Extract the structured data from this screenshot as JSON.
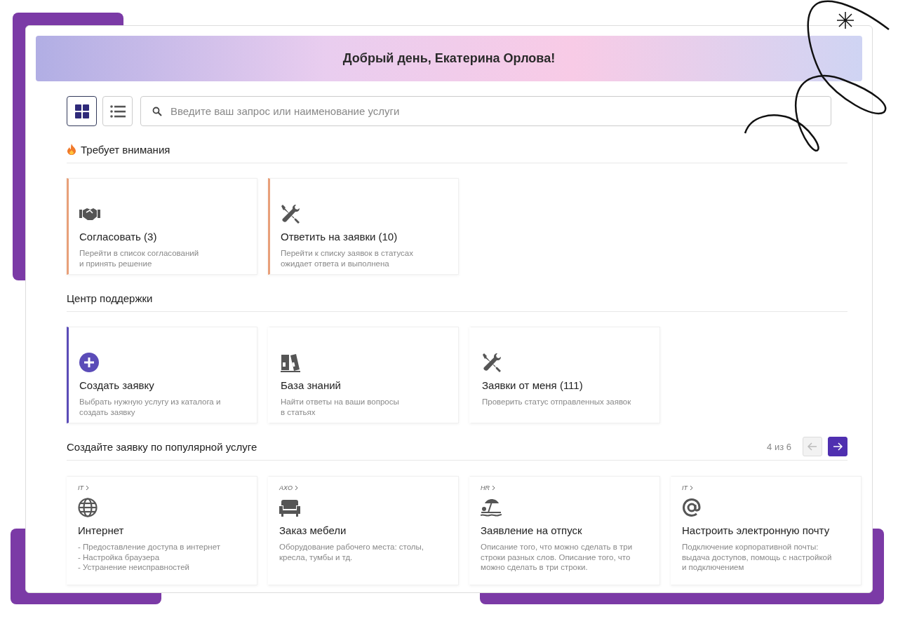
{
  "greeting": "Добрый день, Екатерина Орлова!",
  "view_buttons": [
    {
      "kind": "grid",
      "selected": true
    },
    {
      "kind": "list",
      "selected": false
    }
  ],
  "search": {
    "placeholder": "Введите ваш запрос или наименование услуги"
  },
  "attention": {
    "title": "Требует внимания",
    "cards": [
      {
        "kind": "handshake",
        "title": "Согласовать (3)",
        "lines": [
          "Перейти в список согласований",
          "и принять решение"
        ],
        "color": "#e8a07a"
      },
      {
        "kind": "tools",
        "title": "Ответить на заявки (10)",
        "lines": [
          "Перейти к списку заявок в статусах",
          "ожидает ответа и выполнена"
        ],
        "color": "#e8a07a"
      }
    ]
  },
  "support": {
    "title": "Центр поддержки",
    "cards": [
      {
        "kind": "plus",
        "title": "Создать заявку",
        "lines": [
          "Выбрать нужную услугу из каталога и",
          "создать заявку"
        ],
        "color": "#5b4cb8"
      },
      {
        "kind": "books",
        "title": "База знаний",
        "lines": [
          "Найти ответы на ваши вопросы",
          "в статьях"
        ]
      },
      {
        "kind": "tools",
        "title": "Заявки от меня (111)",
        "lines": [
          "Проверить статус отправленных заявок"
        ]
      }
    ]
  },
  "popular": {
    "title": "Создайте заявку по популярной услуге",
    "pager": "4 из 6",
    "prev_disabled": true,
    "next_disabled": false,
    "cards": [
      {
        "category": "IT",
        "kind": "globe",
        "title": "Интернет",
        "lines": [
          "- Предоставление доступа в интернет",
          "- Настройка браузера",
          "- Устранение неисправностей"
        ]
      },
      {
        "category": "AXO",
        "kind": "chair",
        "title": "Заказ мебели",
        "lines": [
          "Оборудование рабочего места: столы,",
          "кресла, тумбы и тд."
        ]
      },
      {
        "category": "HR",
        "kind": "beach",
        "title": "Заявление на отпуск",
        "lines": [
          "Описание того, что можно сделать в три",
          "строки разных слов. Описание того, что",
          "можно сделать в три строки."
        ]
      },
      {
        "category": "IT",
        "kind": "at",
        "title": "Настроить электронную почту",
        "lines": [
          "Подключение корпоративной почты:",
          "выдача доступов, помощь с настройкой",
          "и подключением"
        ]
      }
    ]
  }
}
